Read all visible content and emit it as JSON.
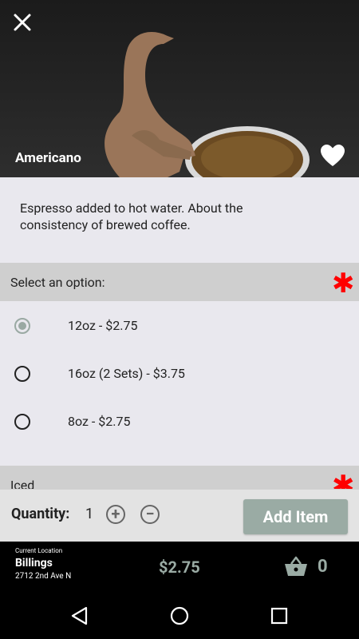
{
  "item": {
    "title": "Americano",
    "description": "Espresso added to hot water.  About the consistency of brewed coffee."
  },
  "sections": [
    {
      "label": "Select an option:",
      "required": true,
      "options": [
        {
          "label": "12oz - $2.75",
          "selected": true
        },
        {
          "label": "16oz (2 Sets) - $3.75",
          "selected": false
        },
        {
          "label": "8oz - $2.75",
          "selected": false
        }
      ]
    },
    {
      "label": "Iced",
      "required": true
    }
  ],
  "required_marker": "✱",
  "quantity": {
    "label": "Quantity:",
    "value": "1",
    "increment_symbol": "+",
    "decrement_symbol": "−"
  },
  "add_button_label": "Add Item",
  "footer": {
    "location_caption": "Current Location",
    "location_city": "Billings",
    "location_address": "2712 2nd Ave N",
    "total": "$2.75",
    "cart_count": "0"
  },
  "icons": {
    "close": "close-icon",
    "favorite": "heart-icon",
    "cart": "basket-icon",
    "back": "back-triangle-icon",
    "home": "home-circle-icon",
    "recents": "recents-square-icon"
  },
  "colors": {
    "accent": "#9aaba4",
    "required": "#ff0000",
    "section_header": "#cfcfcf",
    "background": "#e9e8ee"
  }
}
